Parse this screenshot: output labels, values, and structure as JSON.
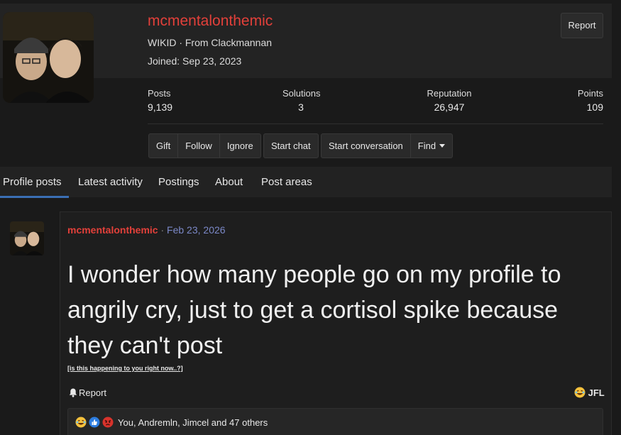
{
  "profile": {
    "username": "mcmentalonthemic",
    "title_line": "WIKID · From Clackmannan",
    "joined": "Joined: Sep 23, 2023",
    "report_label": "Report"
  },
  "stats": [
    {
      "label": "Posts",
      "value": "9,139"
    },
    {
      "label": "Solutions",
      "value": "3"
    },
    {
      "label": "Reputation",
      "value": "26,947"
    },
    {
      "label": "Points",
      "value": "109"
    }
  ],
  "actions": {
    "gift": "Gift",
    "follow": "Follow",
    "ignore": "Ignore",
    "start_chat": "Start chat",
    "start_conversation": "Start conversation",
    "find": "Find"
  },
  "tabs": [
    {
      "label": "Profile posts",
      "active": true
    },
    {
      "label": "Latest activity"
    },
    {
      "label": "Postings"
    },
    {
      "label": "About"
    },
    {
      "label": "Post areas"
    }
  ],
  "post": {
    "author": "mcmentalonthemic",
    "separator": "·",
    "date": "Feb 23, 2026",
    "body": "I wonder how many people go on my profile to angrily cry, just to get a cortisol spike because they can't post",
    "link_text": "[is this happening to you right now..?]",
    "report_label": "Report",
    "react_label": "JFL",
    "reactions_text": "You, Andremln, Jimcel and 47 others"
  },
  "colors": {
    "username": "#e2403a",
    "date": "#7b88c7",
    "active_tab": "#3b6fb5",
    "background": "#1a1a1a"
  }
}
